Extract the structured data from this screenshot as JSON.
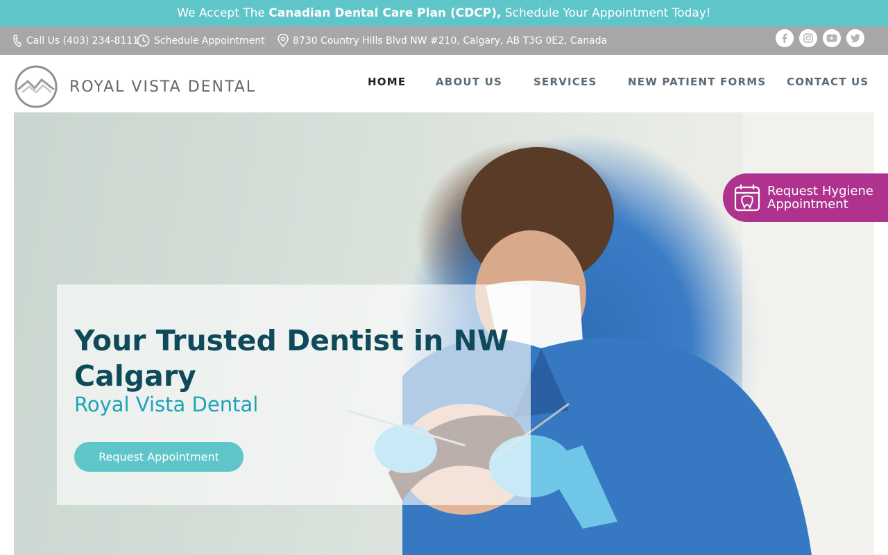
{
  "announcement": {
    "prefix": "We Accept The ",
    "highlight": "Canadian Dental Care Plan (CDCP),",
    "suffix": " Schedule Your Appointment Today!"
  },
  "infobar": {
    "phone": "Call Us (403) 234-8111",
    "schedule": "Schedule Appointment",
    "address": "8730 Country Hills Blvd NW #210, Calgary, AB T3G 0E2, Canada",
    "socials": [
      "facebook-icon",
      "instagram-icon",
      "youtube-icon",
      "twitter-icon"
    ]
  },
  "header": {
    "logo_text": "ROYAL VISTA DENTAL",
    "nav": [
      {
        "label": "HOME",
        "active": true
      },
      {
        "label": "ABOUT US",
        "active": false
      },
      {
        "label": "SERVICES",
        "active": false
      },
      {
        "label": "NEW PATIENT FORMS",
        "active": false
      },
      {
        "label": "CONTACT US",
        "active": false
      }
    ]
  },
  "hero": {
    "title": "Your Trusted Dentist in NW Calgary",
    "subtitle": "Royal Vista Dental",
    "button": "Request Appointment"
  },
  "hygiene_cta": {
    "line1": "Request Hygiene",
    "line2": "Appointment"
  },
  "colors": {
    "accent_teal": "#5ec5c9",
    "info_gray": "#a7a7a7",
    "title_dark": "#0f4a5a",
    "subtitle_teal": "#1fa3b7",
    "cta_magenta": "#b0328f"
  }
}
